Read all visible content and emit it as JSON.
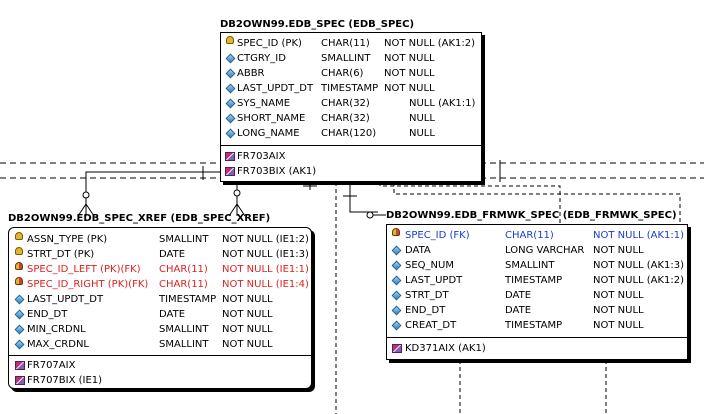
{
  "entities": {
    "spec": {
      "title": "DB2OWN99.EDB_SPEC (EDB_SPEC)",
      "columns": [
        {
          "name": "SPEC_ID (PK)",
          "type": "CHAR(11)",
          "null": "NOT NULL (AK1:2)",
          "icon": "primary-key-icon"
        },
        {
          "name": "CTGRY_ID",
          "type": "SMALLINT",
          "null": "NOT NULL",
          "icon": "column-diamond-icon"
        },
        {
          "name": "ABBR",
          "type": "CHAR(6)",
          "null": "NOT NULL",
          "icon": "column-diamond-icon"
        },
        {
          "name": "LAST_UPDT_DT",
          "type": "TIMESTAMP",
          "null": "NOT NULL",
          "icon": "column-diamond-icon"
        },
        {
          "name": "SYS_NAME",
          "type": "CHAR(32)",
          "null": "NULL (AK1:1)",
          "icon": "column-diamond-icon"
        },
        {
          "name": "SHORT_NAME",
          "type": "CHAR(32)",
          "null": "NULL",
          "icon": "column-diamond-icon"
        },
        {
          "name": "LONG_NAME",
          "type": "CHAR(120)",
          "null": "NULL",
          "icon": "column-diamond-icon"
        }
      ],
      "indexes": [
        "FR703AIX",
        "FR703BIX (AK1)"
      ]
    },
    "xref": {
      "title": "DB2OWN99.EDB_SPEC_XREF (EDB_SPEC_XREF)",
      "columns": [
        {
          "name": "ASSN_TYPE (PK)",
          "type": "SMALLINT",
          "null": "NOT NULL (IE1:2)",
          "icon": "primary-key-icon",
          "style": ""
        },
        {
          "name": "STRT_DT (PK)",
          "type": "DATE",
          "null": "NOT NULL (IE1:3)",
          "icon": "primary-key-icon",
          "style": ""
        },
        {
          "name": "SPEC_ID_LEFT (PK)(FK)",
          "type": "CHAR(11)",
          "null": "NOT NULL (IE1:1)",
          "icon": "foreign-primary-key-icon",
          "style": "red"
        },
        {
          "name": "SPEC_ID_RIGHT (PK)(FK)",
          "type": "CHAR(11)",
          "null": "NOT NULL (IE1:4)",
          "icon": "foreign-primary-key-icon",
          "style": "red"
        },
        {
          "name": "LAST_UPDT_DT",
          "type": "TIMESTAMP",
          "null": "NOT NULL",
          "icon": "column-diamond-icon",
          "style": ""
        },
        {
          "name": "END_DT",
          "type": "DATE",
          "null": "NOT NULL",
          "icon": "column-diamond-icon",
          "style": ""
        },
        {
          "name": "MIN_CRDNL",
          "type": "SMALLINT",
          "null": "NOT NULL",
          "icon": "column-diamond-icon",
          "style": ""
        },
        {
          "name": "MAX_CRDNL",
          "type": "SMALLINT",
          "null": "NOT NULL",
          "icon": "column-diamond-icon",
          "style": ""
        }
      ],
      "indexes": [
        "FR707AIX",
        "FR707BIX (IE1)"
      ]
    },
    "frmwk": {
      "title": "DB2OWN99.EDB_FRMWK_SPEC (EDB_FRMWK_SPEC)",
      "columns": [
        {
          "name": "SPEC_ID (FK)",
          "type": "CHAR(11)",
          "null": "NOT NULL (AK1:1)",
          "icon": "foreign-key-icon",
          "style": "blue"
        },
        {
          "name": "DATA",
          "type": "LONG VARCHAR",
          "null": "NOT NULL",
          "icon": "column-diamond-icon",
          "style": ""
        },
        {
          "name": "SEQ_NUM",
          "type": "SMALLINT",
          "null": "NOT NULL (AK1:3)",
          "icon": "column-diamond-icon",
          "style": ""
        },
        {
          "name": "LAST_UPDT",
          "type": "TIMESTAMP",
          "null": "NOT NULL (AK1:2)",
          "icon": "column-diamond-icon",
          "style": ""
        },
        {
          "name": "STRT_DT",
          "type": "DATE",
          "null": "NOT NULL",
          "icon": "column-diamond-icon",
          "style": ""
        },
        {
          "name": "END_DT",
          "type": "DATE",
          "null": "NOT NULL",
          "icon": "column-diamond-icon",
          "style": ""
        },
        {
          "name": "CREAT_DT",
          "type": "TIMESTAMP",
          "null": "NOT NULL",
          "icon": "column-diamond-icon",
          "style": ""
        }
      ],
      "indexes": [
        "KD371AIX (AK1)"
      ]
    }
  },
  "colors": {
    "fk_text": "#e02020",
    "fk_only_text": "#1a3ccc",
    "key_gold": "#e0b830",
    "column_blue": "#2a7fc6"
  }
}
